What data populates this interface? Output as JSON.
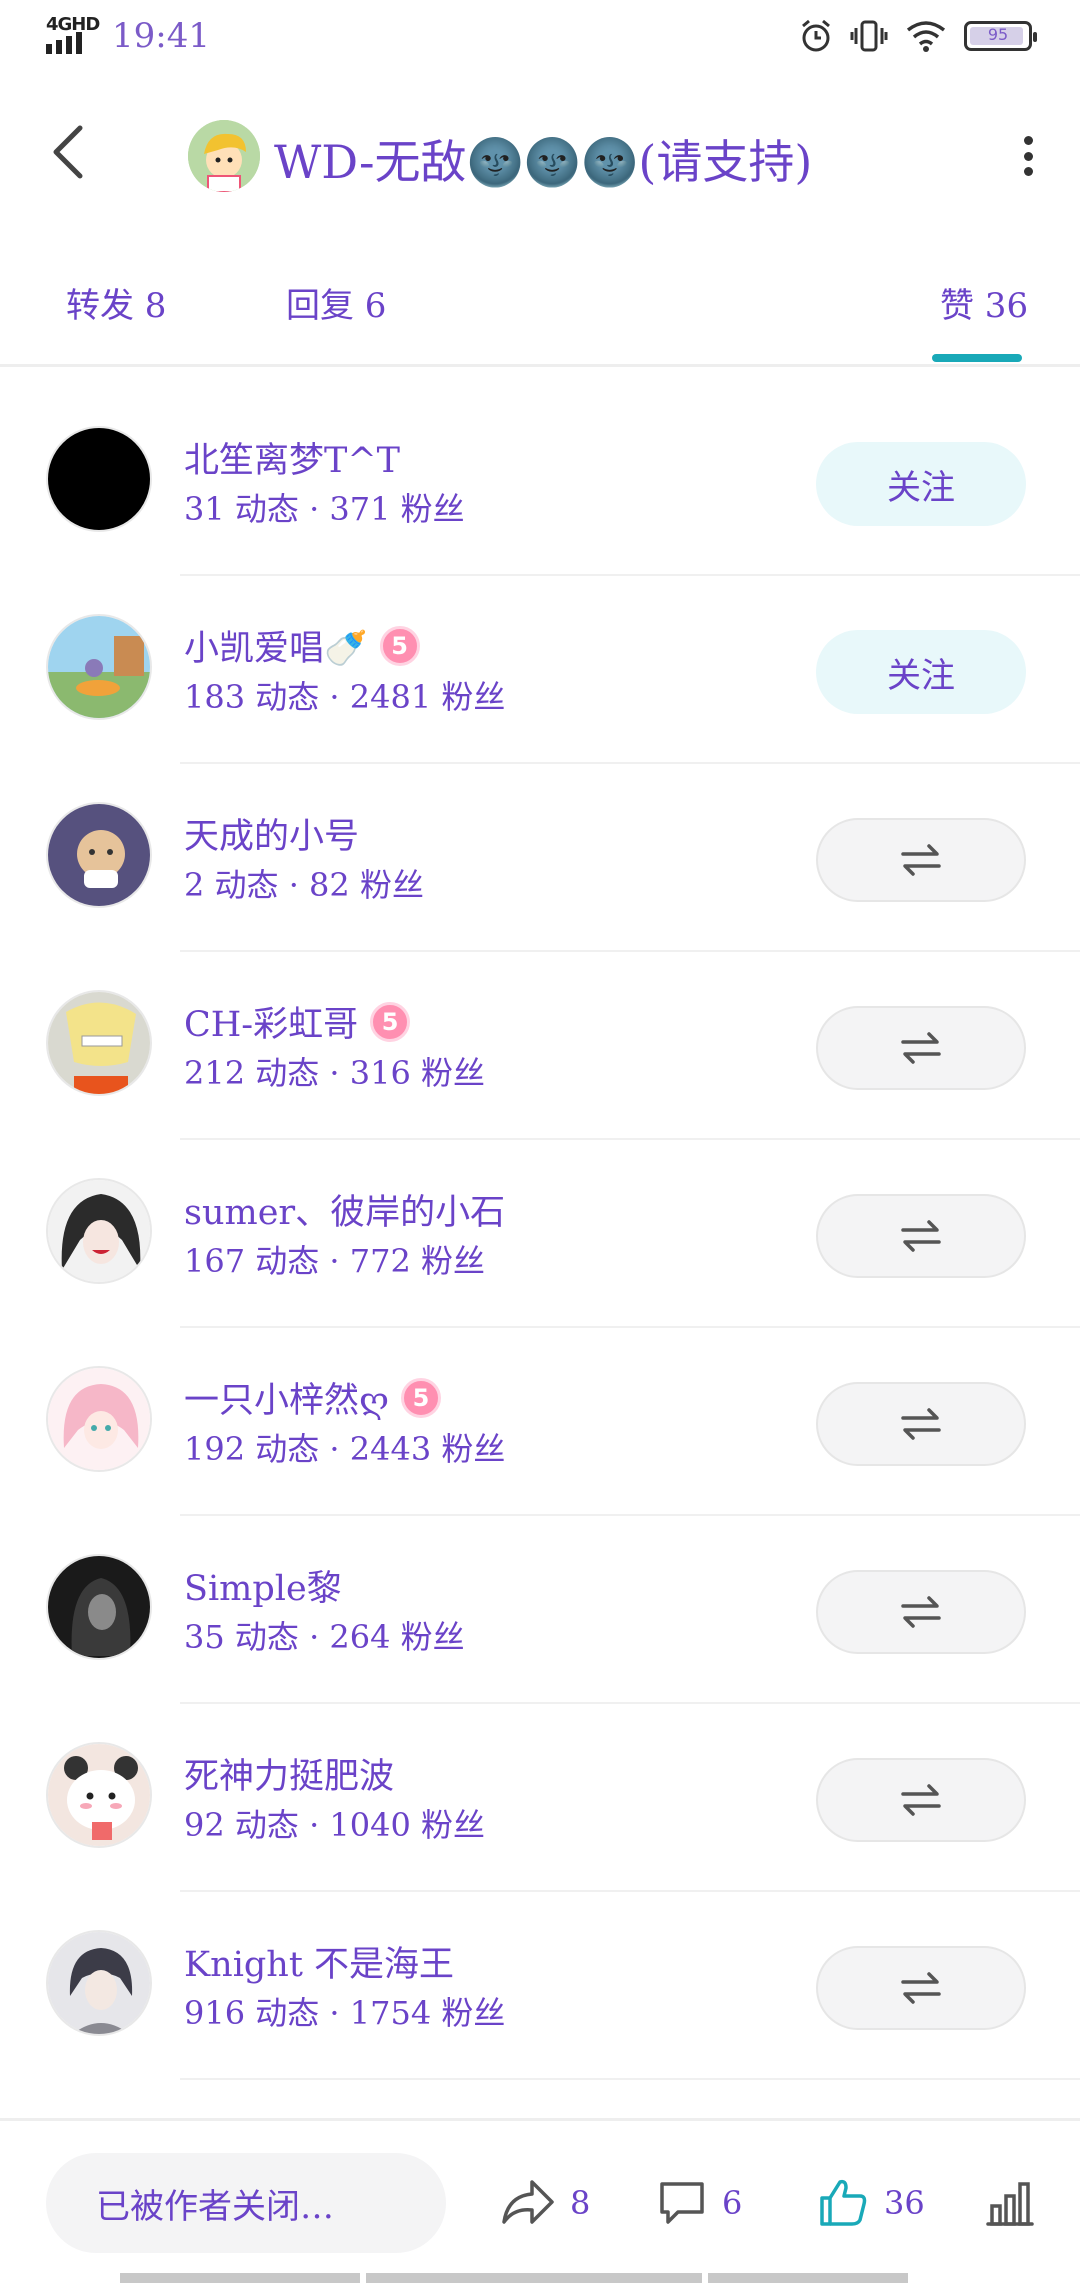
{
  "status_bar": {
    "network": "4GHD",
    "time": "19:41",
    "battery": "95",
    "battery_level": 0.95
  },
  "header": {
    "title": "WD-无敌🌚🌚🌚(请支持)"
  },
  "tabs": [
    {
      "label": "转发 8"
    },
    {
      "label": "回复 6"
    },
    {
      "label": "赞 36"
    }
  ],
  "users": [
    {
      "name": "北笙离梦T^T",
      "badge": "",
      "stats": "31 动态 · 371 粉丝",
      "action": "关注",
      "avatar_color": "#000000"
    },
    {
      "name": "小凯爱唱🍼",
      "badge": "5",
      "stats": "183 动态 · 2481 粉丝",
      "action": "关注",
      "avatar_color": "#8bb96f"
    },
    {
      "name": "天成的小号",
      "badge": "",
      "stats": "2 动态 · 82 粉丝",
      "action": "mutual",
      "avatar_color": "#56517e"
    },
    {
      "name": "CH-彩虹哥",
      "badge": "5",
      "stats": "212 动态 · 316 粉丝",
      "action": "mutual",
      "avatar_color": "#c9c9b0"
    },
    {
      "name": "sumer、彼岸的小石",
      "badge": "",
      "stats": "167 动态 · 772 粉丝",
      "action": "mutual",
      "avatar_color": "#3a3a3a"
    },
    {
      "name": "一只小梓然ღ",
      "badge": "5",
      "stats": "192 动态 · 2443 粉丝",
      "action": "mutual",
      "avatar_color": "#f6c8d4"
    },
    {
      "name": "Simple黎",
      "badge": "",
      "stats": "35 动态 · 264 粉丝",
      "action": "mutual",
      "avatar_color": "#222222"
    },
    {
      "name": "死神力挺肥波",
      "badge": "",
      "stats": "92 动态 · 1040 粉丝",
      "action": "mutual",
      "avatar_color": "#f3e6e0"
    },
    {
      "name": "Knight 不是海王",
      "badge": "",
      "stats": "916 动态 · 1754 粉丝",
      "action": "mutual",
      "avatar_color": "#8a8a92"
    }
  ],
  "bottom_bar": {
    "comment_placeholder": "已被作者关闭…",
    "share_count": "8",
    "comment_count": "6",
    "like_count": "36"
  },
  "colors": {
    "accent": "#19a9b8",
    "text": "#6a43c8",
    "follow_bg": "#e8f8fa"
  }
}
